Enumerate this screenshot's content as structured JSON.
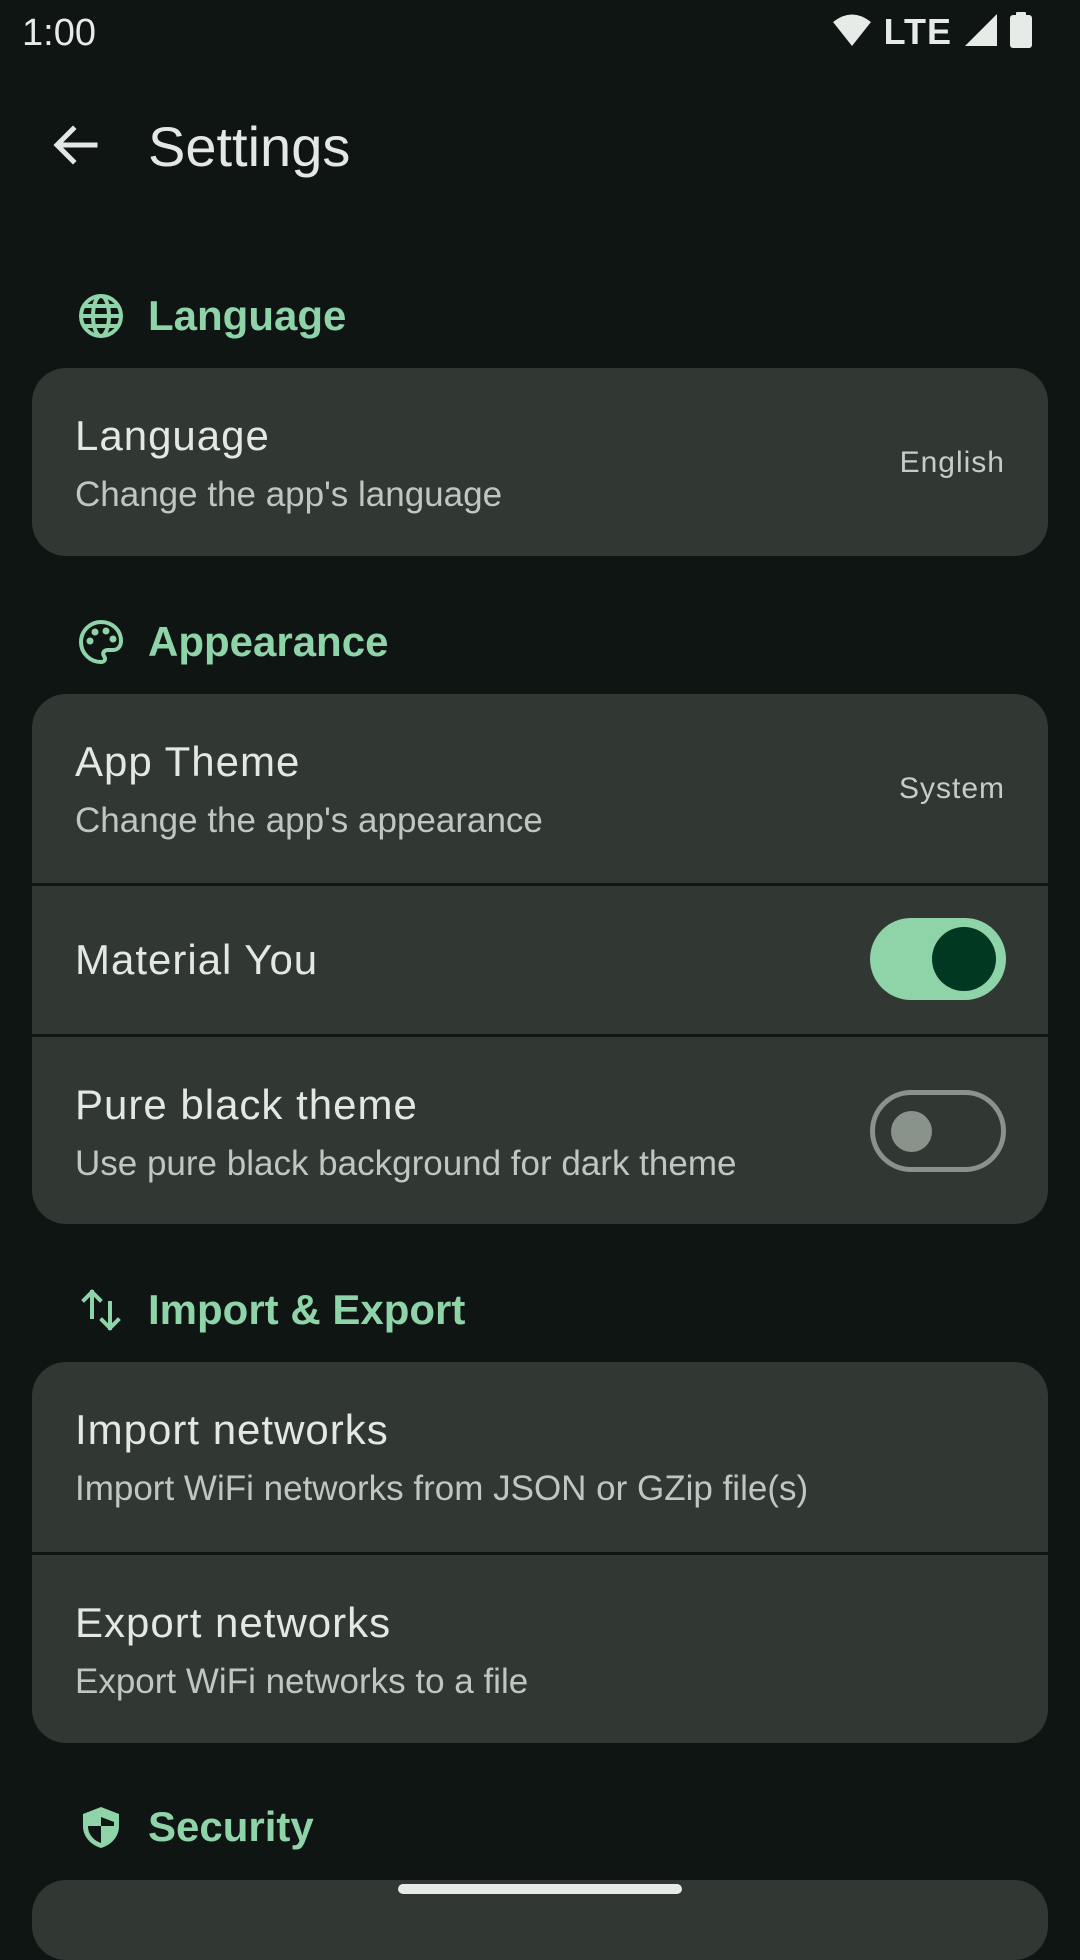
{
  "status_bar": {
    "time": "1:00",
    "network": "LTE"
  },
  "header": {
    "title": "Settings",
    "back_icon": "arrow-back-icon"
  },
  "sections": {
    "language": {
      "title": "Language",
      "icon": "globe-icon",
      "rows": [
        {
          "title": "Language",
          "subtitle": "Change the app's language",
          "value": "English"
        }
      ]
    },
    "appearance": {
      "title": "Appearance",
      "icon": "palette-icon",
      "rows": [
        {
          "title": "App Theme",
          "subtitle": "Change the app's appearance",
          "value": "System"
        },
        {
          "title": "Material You",
          "toggle": true
        },
        {
          "title": "Pure black theme",
          "subtitle": "Use pure black background for dark theme",
          "toggle": false
        }
      ]
    },
    "import_export": {
      "title": "Import & Export",
      "icon": "import-export-icon",
      "rows": [
        {
          "title": "Import networks",
          "subtitle": "Import WiFi networks from JSON or GZip file(s)"
        },
        {
          "title": "Export networks",
          "subtitle": "Export WiFi networks to a file"
        }
      ]
    },
    "security": {
      "title": "Security",
      "icon": "shield-icon"
    }
  },
  "colors": {
    "background": "#0f1513",
    "card": "#313833",
    "accent": "#8fd4a9",
    "switch_thumb_on": "#003822",
    "switch_outline_off": "#8a928c"
  }
}
